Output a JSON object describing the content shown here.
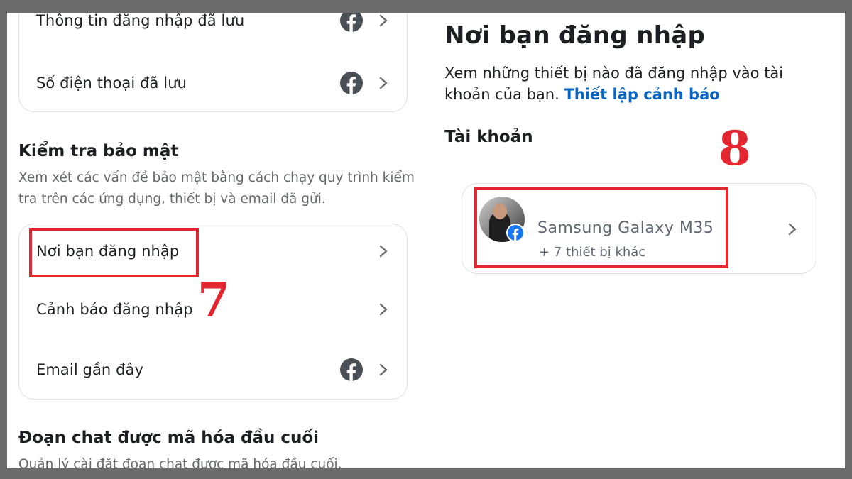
{
  "left": {
    "saved_items": [
      {
        "label": "Thông tin đăng nhập đã lưu",
        "icon": "facebook-icon"
      },
      {
        "label": "Số điện thoại đã lưu",
        "icon": "facebook-icon"
      }
    ],
    "security_check": {
      "title": "Kiểm tra bảo mật",
      "description": "Xem xét các vấn đề bảo mật bằng cách chạy quy trình kiểm tra trên các ứng dụng, thiết bị và email đã gửi."
    },
    "security_items": [
      {
        "label": "Nơi bạn đăng nhập"
      },
      {
        "label": "Cảnh báo đăng nhập"
      },
      {
        "label": "Email gần đây",
        "icon": "facebook-icon"
      }
    ],
    "encrypted_chat": {
      "title": "Đoạn chat được mã hóa đầu cuối",
      "description": "Quản lý cài đặt đoạn chat được mã hóa đầu cuối."
    }
  },
  "right": {
    "title": "Nơi bạn đăng nhập",
    "description": "Xem những thiết bị nào đã đăng nhập vào tài khoản của bạn.",
    "alert_link": "Thiết lập cảnh báo",
    "accounts_title": "Tài khoản",
    "device": {
      "name": "Samsung Galaxy M35",
      "other_devices": "+ 7 thiết bị khác"
    }
  },
  "annotations": {
    "step_7": "7",
    "step_8": "8",
    "highlight_color": "#e3262f"
  },
  "colors": {
    "link": "#0a66c2",
    "facebook": "#1877f2",
    "icon_gray": "#4b4f56"
  }
}
